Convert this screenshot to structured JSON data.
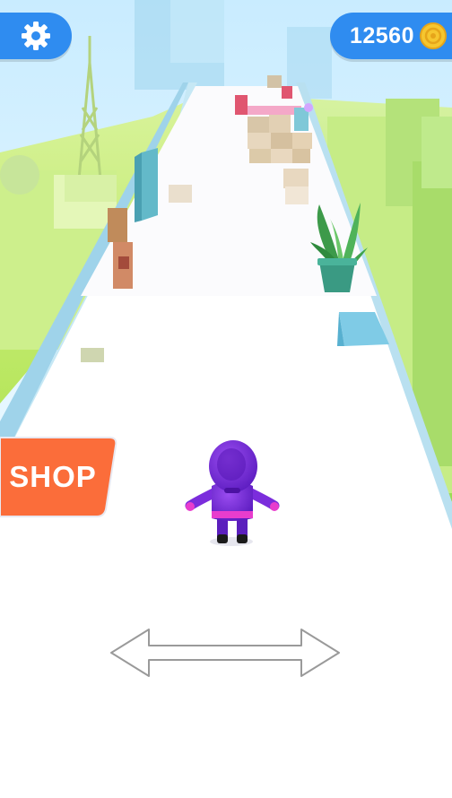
{
  "hud": {
    "settings_icon": "gear-icon",
    "coins": "12560",
    "coin_icon": "coin-icon"
  },
  "shop": {
    "label": "SHOP"
  },
  "hint": {
    "icon": "double-arrow-icon"
  },
  "colors": {
    "hud_blue": "#2f8cf0",
    "shop_orange": "#fb6d3a",
    "player_purple": "#7b2ddc",
    "track": "#ffffff",
    "ground_green": "#c9ef7d"
  }
}
